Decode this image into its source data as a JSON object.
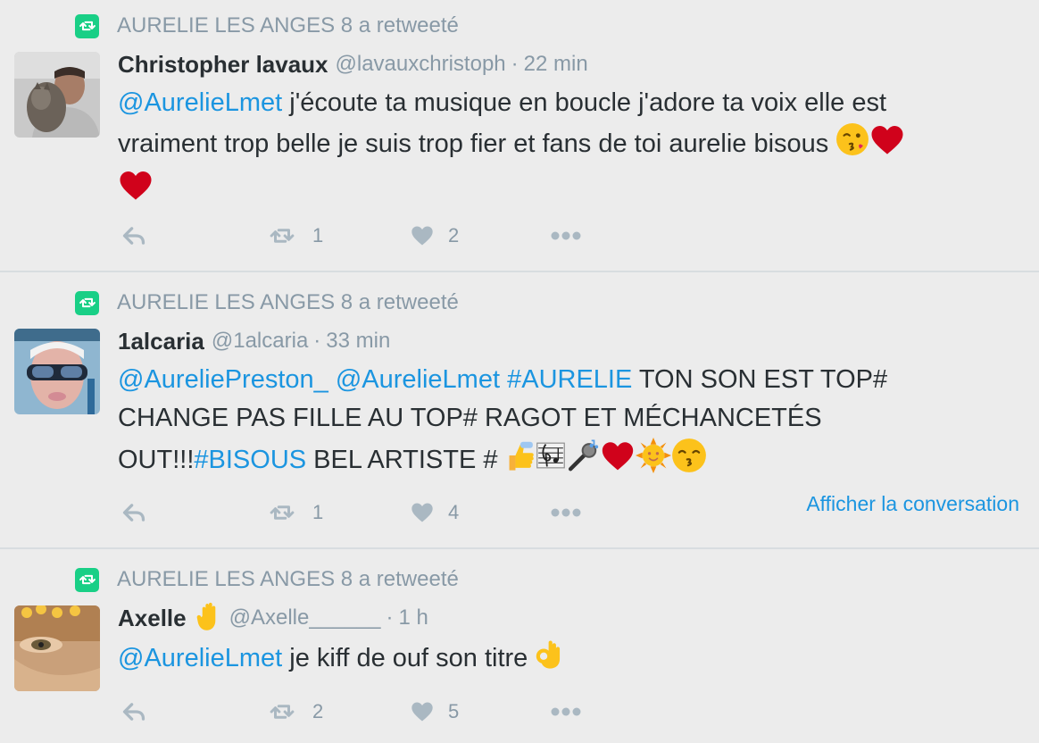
{
  "tweets": [
    {
      "retweeted_by": "AURELIE LES ANGES 8 a retweeté",
      "name": "Christopher lavaux",
      "handle": "@lavauxchristoph",
      "time": "22 min",
      "text_mention": "@AurelieLmet",
      "text_line1": " j'écoute ta musique en boucle j'adore ta voix elle est",
      "text_line2": "vraiment trop belle je suis trop fier et fans de toi aurelie bisous ",
      "retweets": "1",
      "likes": "2"
    },
    {
      "retweeted_by": "AURELIE LES ANGES 8 a retweeté",
      "name": "1alcaria",
      "handle": "@1alcaria",
      "time": "33 min",
      "text_mention1": "@AureliePreston_",
      "text_mention2": "@AurelieLmet",
      "text_hashtag1": "#AURELIE",
      "text_rest1": " TON SON EST TOP#",
      "text_line2": "CHANGE PAS FILLE AU TOP# RAGOT ET MÉCHANCETÉS",
      "text_line3a": "OUT!!!",
      "text_hashtag2": "#BISOUS",
      "text_line3b": " BEL ARTISTE # ",
      "retweets": "1",
      "likes": "4",
      "conversation_link": "Afficher la conversation"
    },
    {
      "retweeted_by": "AURELIE LES ANGES 8 a retweeté",
      "name": "Axelle",
      "handle": "@Axelle______",
      "time": "1 h",
      "text_mention": "@AurelieLmet",
      "text_rest": " je kiff de ouf son titre ",
      "retweets": "2",
      "likes": "5"
    }
  ],
  "colors": {
    "background": "#ececec",
    "link": "#1b95e0",
    "muted": "#8899a6",
    "retweet_badge": "#19cf86",
    "heart": "#d0021b"
  },
  "icons": [
    "retweet-icon",
    "reply-icon",
    "like-icon",
    "more-icon",
    "kiss-emoji",
    "heart-emoji",
    "thumbs-up-emoji",
    "music-score-emoji",
    "microphone-emoji",
    "sun-emoji",
    "kissing-emoji",
    "raised-hand-emoji",
    "ok-hand-emoji"
  ]
}
